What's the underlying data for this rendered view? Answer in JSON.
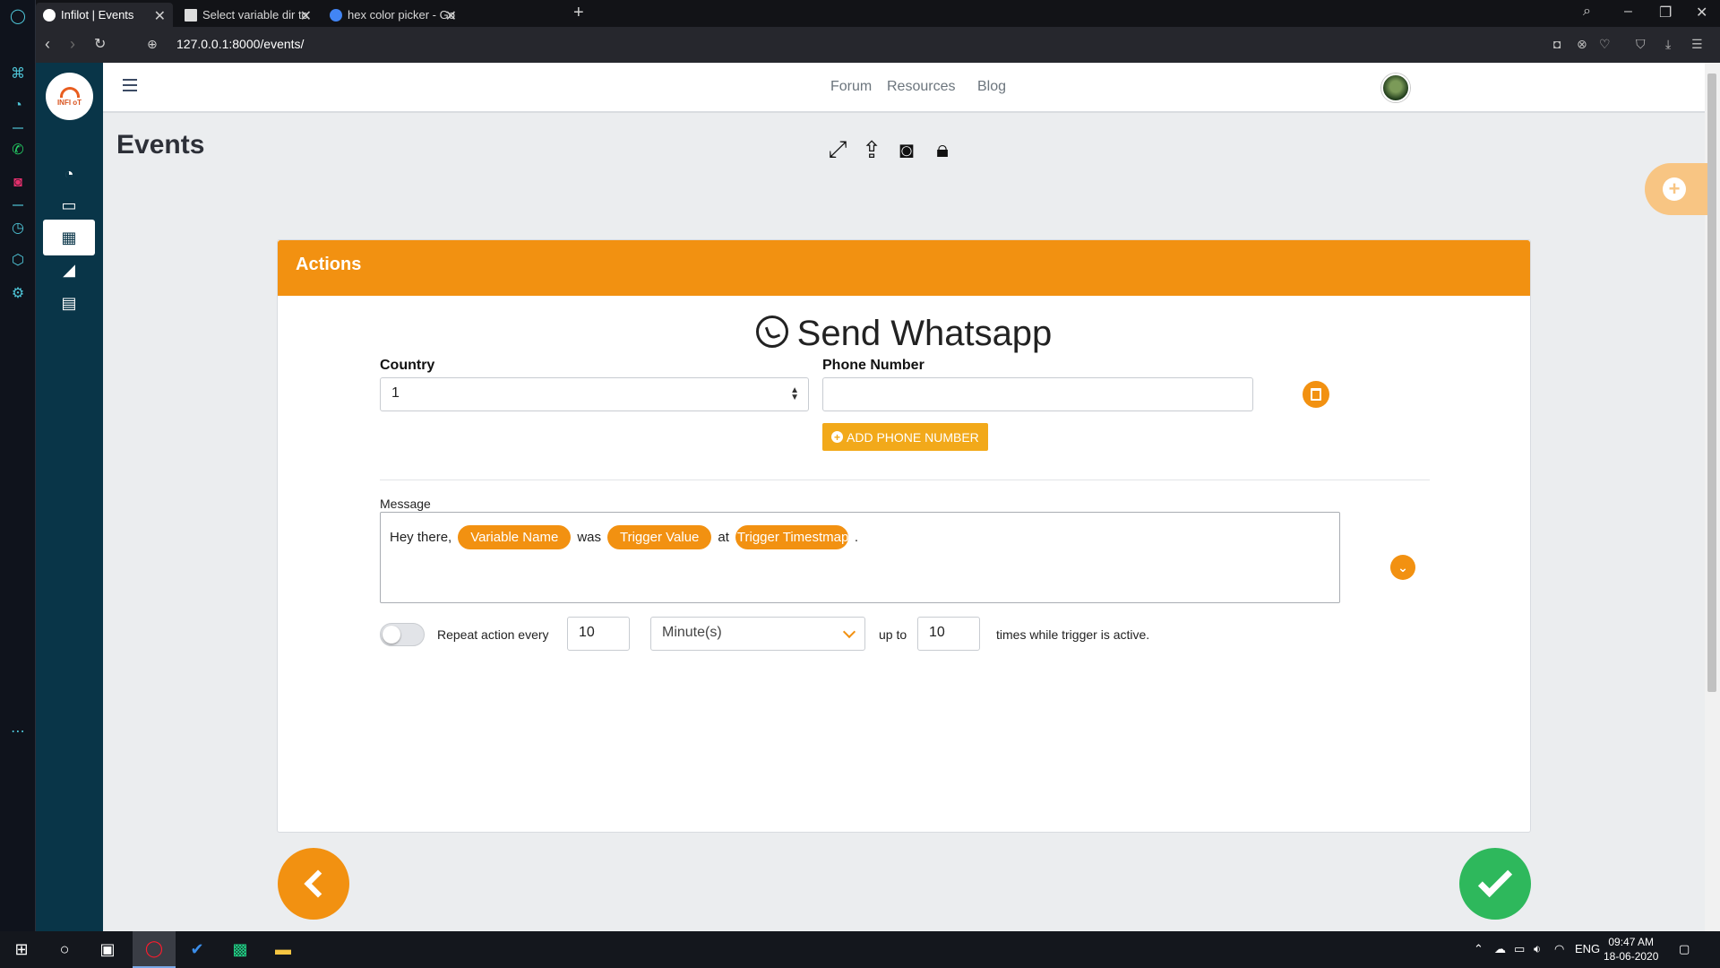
{
  "browser": {
    "tabs": [
      {
        "title": "Infilot | Events",
        "favicon_color": "#ffffff",
        "active": true
      },
      {
        "title": "Select variable dir to chang",
        "favicon_color": "#dddddd",
        "active": false
      },
      {
        "title": "hex color picker - Google S",
        "favicon_color": "#4285f4",
        "active": false
      }
    ],
    "url": "127.0.0.1:8000/events/"
  },
  "topnav": {
    "links": [
      "Forum",
      "Resources",
      "Blog"
    ]
  },
  "logo": {
    "text": "INFI oT"
  },
  "page": {
    "title": "Events"
  },
  "card": {
    "header": "Actions",
    "action_title": "Send Whatsapp",
    "country_label": "Country",
    "country_value": "1",
    "phone_label": "Phone Number",
    "phone_value": "",
    "add_phone_label": "ADD PHONE NUMBER",
    "message_label": "Message",
    "message": {
      "prefix": "Hey there,",
      "chip1": "Variable Name",
      "word1": "was",
      "chip2": "Trigger Value",
      "word2": "at",
      "chip3": "Trigger Timestmap",
      "suffix": "."
    },
    "repeat": {
      "enabled": false,
      "label": "Repeat action every",
      "interval": "10",
      "unit": "Minute(s)",
      "upto_label": "up to",
      "times": "10",
      "suffix": "times while trigger is active."
    }
  },
  "taskbar": {
    "language": "ENG",
    "time": "09:47 AM",
    "date": "18-06-2020"
  },
  "colors": {
    "accent": "#f29111",
    "sidebar": "#093548",
    "success": "#2eb85c"
  }
}
